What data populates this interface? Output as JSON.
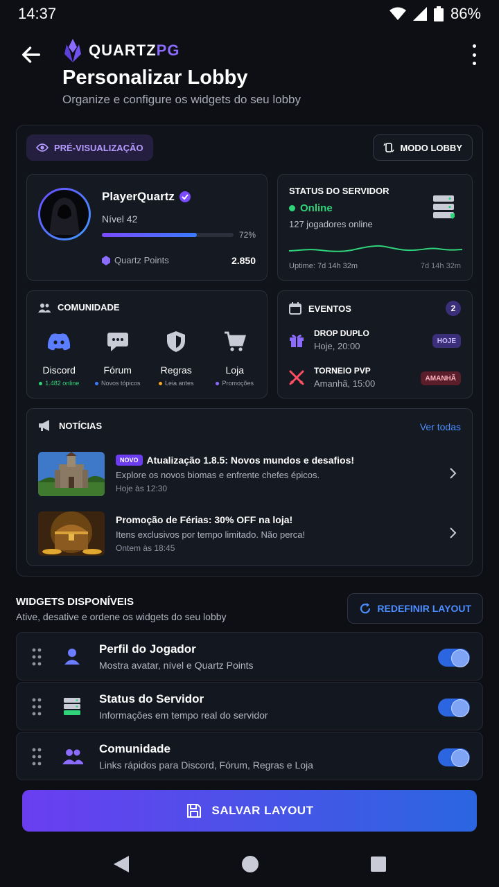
{
  "status_bar": {
    "time": "14:37",
    "battery": "86%"
  },
  "header": {
    "brand_main": "QUARTZ",
    "brand_accent": "PG",
    "title": "Personalizar Lobby",
    "subtitle": "Organize e configure os widgets do seu lobby"
  },
  "preview": {
    "pill_label": "PRÉ-VISUALIZAÇÃO",
    "mode_label": "MODO LOBBY",
    "player": {
      "name": "PlayerQuartz",
      "level": "Nível 42",
      "xp_percent_label": "72%",
      "xp_fraction": 0.72,
      "points_label": "Quartz Points",
      "points_value": "2.850"
    },
    "server": {
      "title": "STATUS DO SERVIDOR",
      "status": "Online",
      "players": "127 jogadores online",
      "uptime": "Uptime: 7d 14h 32m",
      "uptime_repeat": "7d 14h 32m"
    },
    "community": {
      "title": "COMUNIDADE",
      "items": [
        {
          "label": "Discord",
          "sub": "1.482 online",
          "dot": "#2fd37a",
          "icon": "discord-icon"
        },
        {
          "label": "Fórum",
          "sub": "Novos tópicos",
          "dot": "#3a7bff",
          "icon": "forum-icon"
        },
        {
          "label": "Regras",
          "sub": "Leia antes",
          "dot": "#f5a623",
          "icon": "shield-icon"
        },
        {
          "label": "Loja",
          "sub": "Promoções",
          "dot": "#8b6cff",
          "icon": "cart-icon"
        }
      ]
    },
    "events": {
      "title": "EVENTOS",
      "count": "2",
      "items": [
        {
          "name": "DROP DUPLO",
          "time": "Hoje, 20:00",
          "tag": "HOJE",
          "tag_bg": "#3b2f7a",
          "tag_color": "#cbbcff"
        },
        {
          "name": "TORNEIO PVP",
          "time": "Amanhã, 15:00",
          "tag": "AMANHÃ",
          "tag_bg": "#5a1e2b",
          "tag_color": "#ffb3bf"
        }
      ]
    },
    "news": {
      "title": "NOTÍCIAS",
      "see_all": "Ver todas",
      "items": [
        {
          "badge": "NOVO",
          "title": "Atualização 1.8.5: Novos mundos e desafios!",
          "desc": "Explore os novos biomas e enfrente chefes épicos.",
          "time": "Hoje às 12:30"
        },
        {
          "badge": "",
          "title": "Promoção de Férias: 30% OFF na loja!",
          "desc": "Itens exclusivos por tempo limitado. Não perca!",
          "time": "Ontem às 18:45"
        }
      ]
    }
  },
  "widgets": {
    "title": "WIDGETS DISPONÍVEIS",
    "subtitle": "Ative, desative e ordene os widgets do seu lobby",
    "reset_label": "REDEFINIR LAYOUT",
    "items": [
      {
        "title": "Perfil do Jogador",
        "sub": "Mostra avatar, nível e Quartz Points",
        "enabled": true
      },
      {
        "title": "Status do Servidor",
        "sub": "Informações em tempo real do servidor",
        "enabled": true
      },
      {
        "title": "Comunidade",
        "sub": "Links rápidos para Discord, Fórum, Regras e Loja",
        "enabled": true
      }
    ]
  },
  "save_label": "SALVAR LAYOUT",
  "colors": {
    "accent": "#6a3ef0",
    "link": "#4c8dff",
    "online": "#2fd37a"
  }
}
